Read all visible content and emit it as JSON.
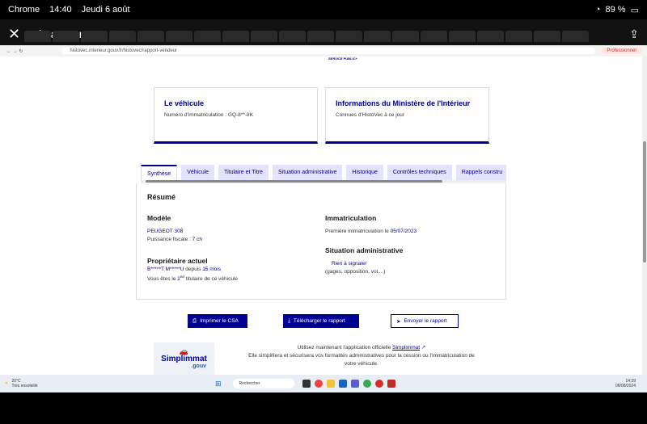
{
  "status_bar": {
    "carrier": "Chrome",
    "time": "14:40",
    "date": "Jeudi 6 août",
    "battery": "89 %"
  },
  "viewer": {
    "filename": "image.png"
  },
  "browser": {
    "url": "histovec.interieur.gouv.fr/histovec/rapport-vendeur",
    "profile": "Professionnel"
  },
  "logo_text": "SERVICE PUBLIC+",
  "cards": [
    {
      "title": "Le véhicule",
      "text": "Numéro d'immatriculation : GQ-8**-8K"
    },
    {
      "title": "Informations du Ministère de l'Intérieur",
      "text": "Connues d'HistoVec à ce jour"
    }
  ],
  "tabs": [
    "Synthèse",
    "Véhicule",
    "Titulaire et Titre",
    "Situation administrative",
    "Historique",
    "Contrôles techniques",
    "Rappels constru"
  ],
  "resume": {
    "title": "Résumé",
    "modele": {
      "heading": "Modèle",
      "name": "PEUGEOT 308",
      "fiscal_label": "Puissance fiscale :",
      "fiscal_value": "7 ch"
    },
    "proprietaire": {
      "heading": "Propriétaire actuel",
      "owner": "B*****T M*****U",
      "since_label": "depuis",
      "since_value": "15 mois",
      "rank_prefix": "Vous êtes le",
      "rank": "2",
      "rank_sup": "nd",
      "rank_suffix": "titulaire de ce véhicule"
    },
    "immat": {
      "heading": "Immatriculation",
      "label": "Première immatriculation le",
      "date": "05/07/2023"
    },
    "situation": {
      "heading": "Situation administrative",
      "status": "Rien à signaler",
      "detail": "(gages, opposition, vol,...)"
    }
  },
  "actions": {
    "print": "Imprimer le CSA",
    "download": "Télécharger le rapport",
    "send": "Envoyer le rapport"
  },
  "promo": {
    "logo_main": "Simplimmat",
    "logo_sub": ".gouv",
    "line1_prefix": "Utilisez maintenant l'application officielle",
    "link": "Simplimmat",
    "line2": "Elle simplifiera et sécurisera vos formalités administratives pour la cession ou l'immatriculation de",
    "line3": "votre véhicule."
  },
  "taskbar": {
    "temp": "20°C",
    "weather": "Très ensoleillé",
    "search": "Rechercher",
    "clock_time": "14:39",
    "clock_date": "06/08/2024"
  }
}
